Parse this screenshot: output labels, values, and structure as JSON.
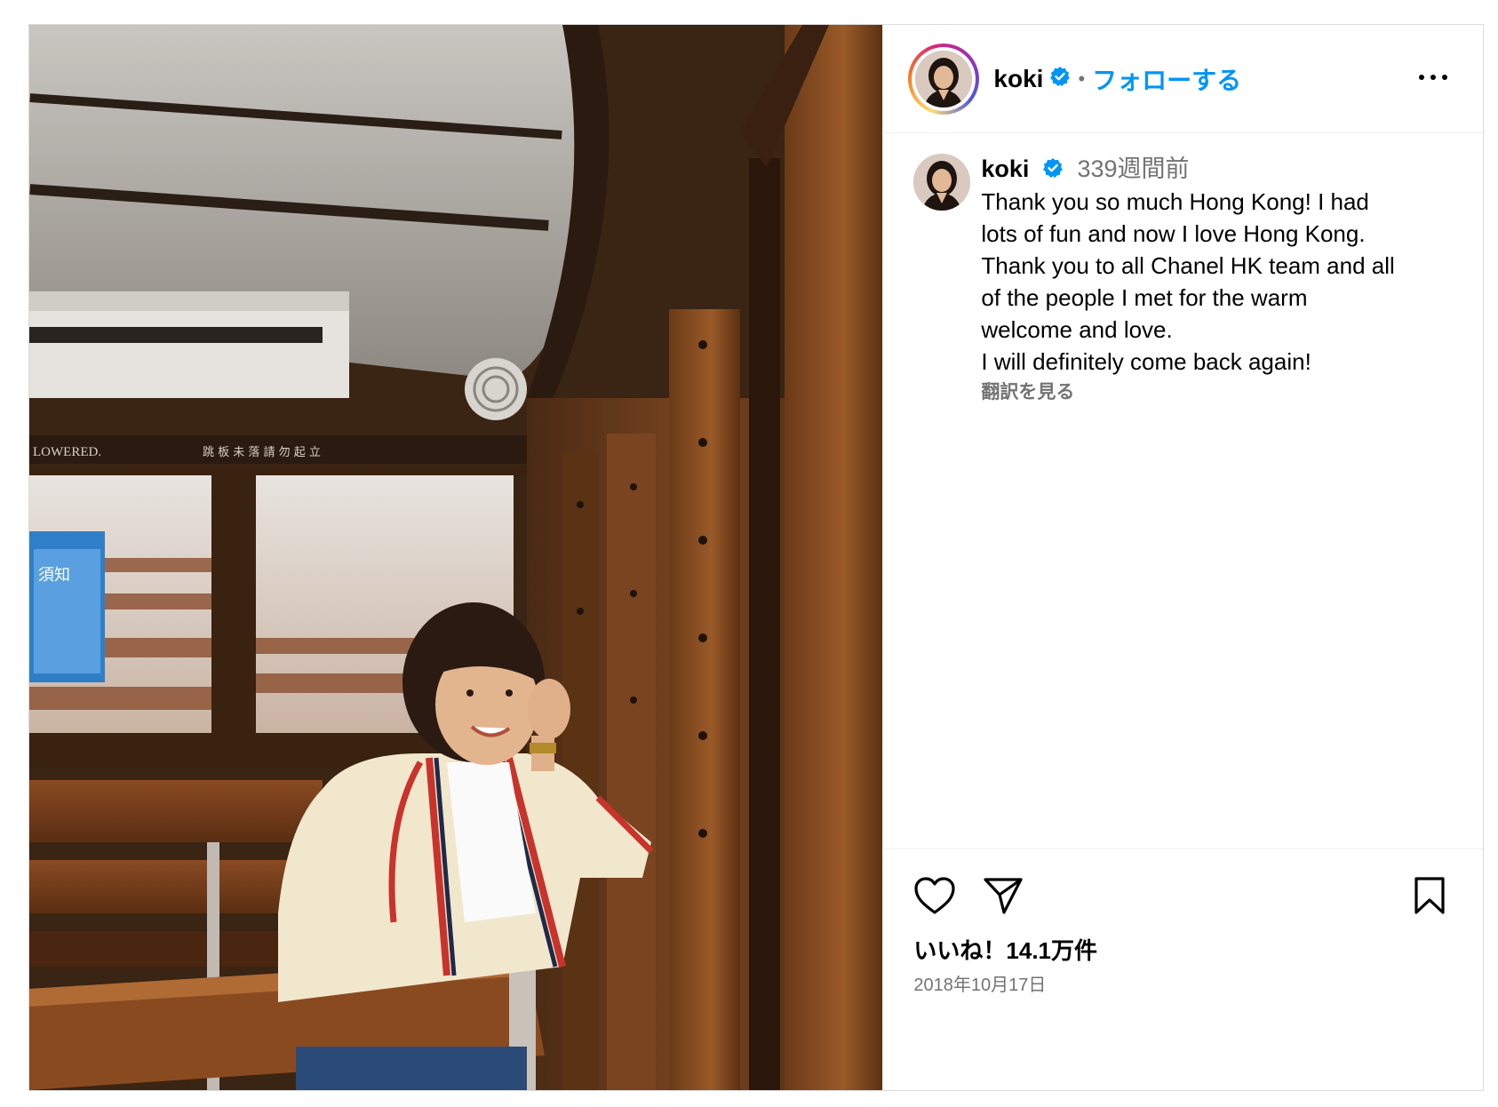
{
  "header": {
    "username": "koki",
    "separator": "•",
    "follow_label": "フォローする"
  },
  "caption": {
    "username": "koki",
    "time_ago": "339週間前",
    "text": "Thank you so much Hong Kong! I had\nlots of fun and now I love Hong Kong.\nThank you to all Chanel HK team and all\nof the people I met for the warm\nwelcome and love.\nI will definitely come back again!",
    "translate_label": "翻訳を見る"
  },
  "photo": {
    "sign_text": "LOWERED.",
    "sign_chinese": "跳 板 未 落 請 勿 起 立",
    "notice_text": "須知"
  },
  "footer": {
    "likes": "いいね！14.1万件",
    "date": "2018年10月17日"
  },
  "colors": {
    "link_blue": "#0095f6",
    "verified_blue": "#0095f6",
    "muted_gray": "#737373",
    "border_gray": "#dbdbdb"
  },
  "icons": [
    "verified-badge-icon",
    "more-options-icon",
    "heart-icon",
    "share-icon",
    "bookmark-icon"
  ]
}
